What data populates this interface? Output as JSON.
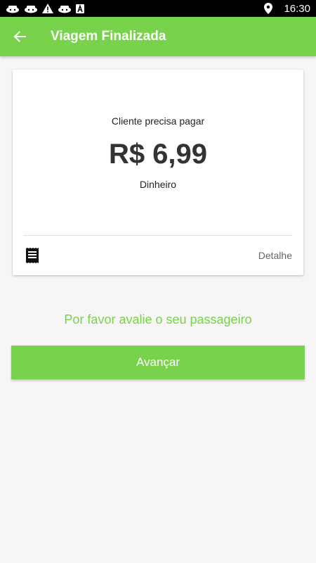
{
  "status_bar": {
    "time": "16:30",
    "notification_icons": [
      "android-bot-icon",
      "android-bot-icon",
      "warning-icon",
      "android-bot-icon",
      "app-a-icon"
    ],
    "right_icons": [
      "location-pin-icon"
    ]
  },
  "app_bar": {
    "back_icon": "arrow-back-icon",
    "title": "Viagem Finalizada"
  },
  "payment_card": {
    "label": "Cliente precisa pagar",
    "amount": "R$ 6,99",
    "method": "Dinheiro",
    "receipt_icon": "receipt-icon",
    "detail_label": "Detalhe"
  },
  "rating": {
    "prompt": "Por favor avalie o seu passageiro"
  },
  "actions": {
    "advance_label": "Avançar"
  },
  "colors": {
    "primary": "#78d24b",
    "background": "#f7f5f5",
    "status_bar": "#000000",
    "amount_text": "#333333"
  }
}
